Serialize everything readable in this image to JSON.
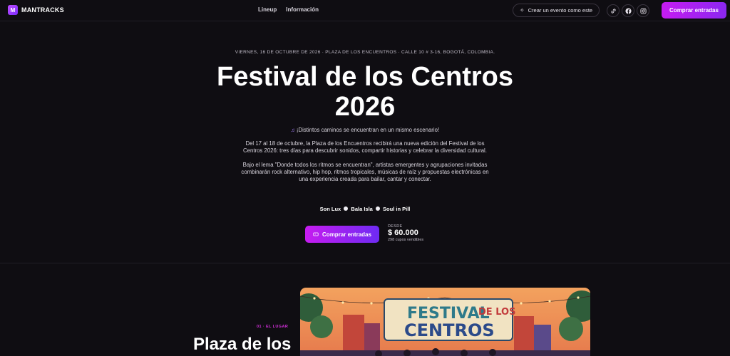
{
  "brand": {
    "logo_letter": "M",
    "name": "MANTRACKS"
  },
  "nav": {
    "links": [
      "Lineup",
      "Información"
    ]
  },
  "header": {
    "create_label": "Crear un evento como este",
    "buy_label": "Comprar entradas",
    "social_icons": [
      "link-icon",
      "facebook-icon",
      "instagram-icon"
    ]
  },
  "hero": {
    "meta": "VIERNES, 16 DE OCTUBRE DE 2026 · PLAZA DE LOS ENCUENTROS · CALLE 10 # 3-16, BOGOTÁ, COLOMBIA.",
    "title_line1": "Festival de los Centros",
    "title_line2": "2026",
    "tagline": "¡Distintos caminos se encuentran en un mismo escenario!",
    "paragraph1": "Del 17 al 18 de octubre, la Plaza de los Encuentros recibirá una nueva edición del Festival de los Centros 2026: tres días para descubrir sonidos, compartir historias y celebrar la diversidad cultural.",
    "paragraph2": "Bajo el lema \"Donde todos los ritmos se encuentran\", artistas emergentes y agrupaciones invitadas combinarán rock alternativo, hip hop, ritmos tropicales, músicas de raíz y propuestas electrónicas en una experiencia creada para bailar, cantar y conectar.",
    "lineup": [
      "Son Lux",
      "Bala Isla",
      "Soul in Pill"
    ],
    "buy_label": "Comprar entradas",
    "price_label": "DESDE",
    "price_value": "$ 60.000",
    "price_sub": "298 cupos vendibles"
  },
  "section": {
    "tag": "01 · EL LUGAR",
    "title": "Plaza de los"
  },
  "poster": {
    "line1": "FESTIVAL",
    "line2": "DE LOS",
    "line3": "CENTROS"
  },
  "colors": {
    "accent_start": "#c61cf0",
    "accent_end": "#7a2bf2",
    "background": "#0f0d12"
  }
}
